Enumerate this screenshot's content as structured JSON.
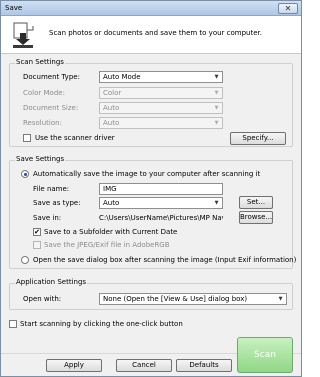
{
  "window": {
    "title": "Save",
    "close_glyph": "✕"
  },
  "header": {
    "description": "Scan photos or documents and save them to your computer.",
    "icon": "scanner-save-icon"
  },
  "scan_settings": {
    "title": "Scan Settings",
    "document_type": {
      "label": "Document Type:",
      "value": "Auto Mode"
    },
    "color_mode": {
      "label": "Color Mode:",
      "value": "Color"
    },
    "document_size": {
      "label": "Document Size:",
      "value": "Auto"
    },
    "resolution": {
      "label": "Resolution:",
      "value": "Auto"
    },
    "use_driver": {
      "label": "Use the scanner driver",
      "checked": false
    },
    "specify_button": "Specify..."
  },
  "save_settings": {
    "title": "Save Settings",
    "auto_save": {
      "label": "Automatically save the image to your computer after scanning it",
      "selected": true
    },
    "file_name": {
      "label": "File name:",
      "value": "IMG"
    },
    "save_as_type": {
      "label": "Save as type:",
      "value": "Auto"
    },
    "set_button": "Set...",
    "save_in": {
      "label": "Save in:",
      "value": "C:\\Users\\UserName\\Pictures\\MP Navigator"
    },
    "browse_button": "Browse...",
    "subfolder": {
      "label": "Save to a Subfolder with Current Date",
      "checked": true,
      "mark": "✔"
    },
    "adobergb": {
      "label": "Save the JPEG/Exif file in AdobeRGB",
      "checked": false
    },
    "open_dialog": {
      "label": "Open the save dialog box after scanning the image (Input Exif information)",
      "selected": false
    }
  },
  "application_settings": {
    "title": "Application Settings",
    "open_with": {
      "label": "Open with:",
      "value": "None (Open the [View & Use] dialog box)"
    }
  },
  "one_click": {
    "label": "Start scanning by clicking the one-click button",
    "checked": false
  },
  "buttons": {
    "apply": "Apply",
    "cancel": "Cancel",
    "defaults": "Defaults",
    "scan": "Scan"
  },
  "colors": {
    "scan_button": "#9ddc94",
    "title_bar": "#bcd3ee",
    "radio_dot": "#1e4d99"
  }
}
